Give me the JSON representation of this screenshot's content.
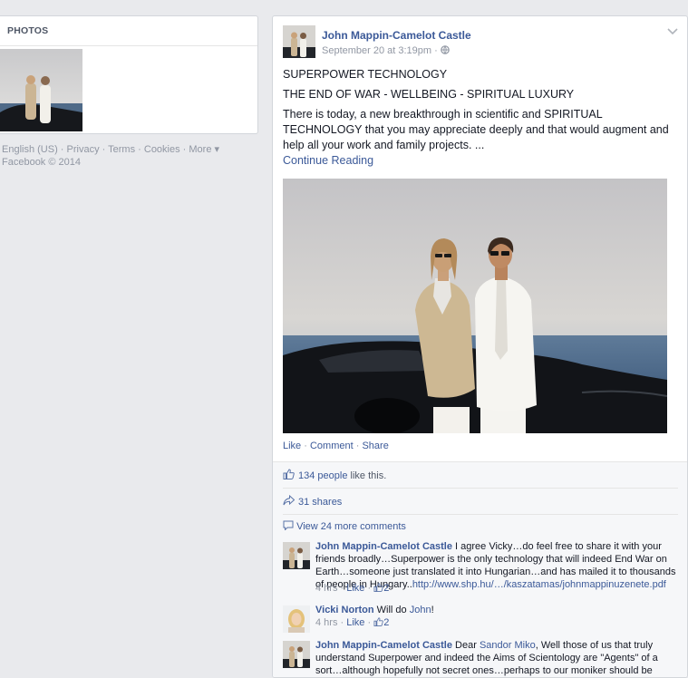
{
  "left": {
    "photos_heading": "PHOTOS",
    "footer_line1": "English (US) · Privacy · Terms · Cookies · More ▾",
    "footer_line2": "Facebook © 2014"
  },
  "post": {
    "author": "John Mappin-Camelot Castle",
    "date": "September 20 at 3:19pm",
    "privacy_icon": "globe-icon",
    "line1": "SUPERPOWER TECHNOLOGY",
    "line2": "THE END OF WAR - WELLBEING - SPIRITUAL LUXURY",
    "body": "There is today, a new breakthrough in scientific and SPIRITUAL TECHNOLOGY that you may appreciate deeply and that would augment and help all your work and family projects. ...",
    "continue": "Continue Reading",
    "actions": {
      "like": "Like",
      "comment": "Comment",
      "share": "Share"
    }
  },
  "ufi": {
    "likes_link": "134 people",
    "likes_suffix": " like this.",
    "shares": "31 shares",
    "more_comments": "View 24 more comments"
  },
  "comments": [
    {
      "author": "John Mappin-Camelot Castle",
      "text": " I agree Vicky…do feel free to share it with your friends broadly…Superpower is the only technology that will indeed End War on Earth…someone just translated it into Hungarian…and has mailed it to thousands of people in Hungary..",
      "link": "http://www.shp.hu/…/kaszatamas/johnmappinuzenete.pdf",
      "time": "4 hrs",
      "like": "Like",
      "likes": "2"
    },
    {
      "author": "Vicki Norton",
      "text_pre": " Will do ",
      "mention": "John",
      "text_post": "!",
      "time": "4 hrs",
      "like": "Like",
      "likes": "2"
    },
    {
      "author": "John Mappin-Camelot Castle",
      "text_pre": " Dear ",
      "mention": "Sandor Miko",
      "text_post": ", Well those of us that truly understand Superpower and indeed the Aims of Scientology are \"Agents\" of a sort…although hopefully not secret ones…perhaps to our moniker should be added -"
    }
  ]
}
